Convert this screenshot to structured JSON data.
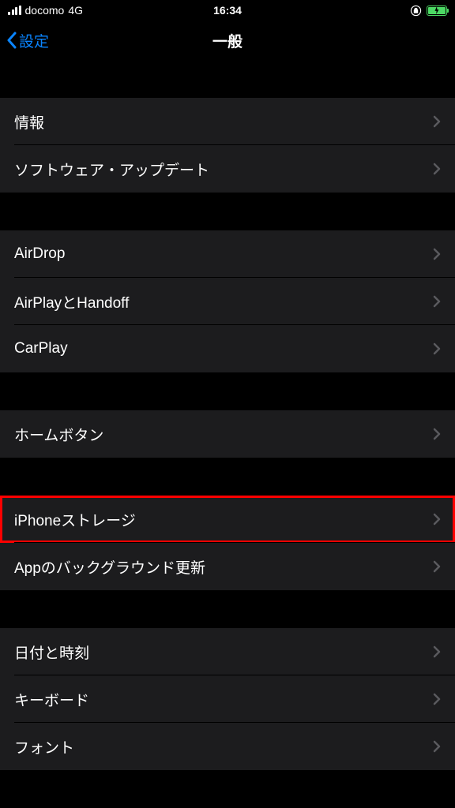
{
  "statusBar": {
    "carrier": "docomo",
    "network": "4G",
    "time": "16:34"
  },
  "nav": {
    "back": "設定",
    "title": "一般"
  },
  "sections": [
    {
      "items": [
        {
          "label": "情報"
        },
        {
          "label": "ソフトウェア・アップデート"
        }
      ]
    },
    {
      "items": [
        {
          "label": "AirDrop"
        },
        {
          "label": "AirPlayとHandoff"
        },
        {
          "label": "CarPlay"
        }
      ]
    },
    {
      "items": [
        {
          "label": "ホームボタン"
        }
      ]
    },
    {
      "items": [
        {
          "label": "iPhoneストレージ"
        },
        {
          "label": "Appのバックグラウンド更新"
        }
      ]
    },
    {
      "items": [
        {
          "label": "日付と時刻"
        },
        {
          "label": "キーボード"
        },
        {
          "label": "フォント"
        }
      ]
    }
  ]
}
